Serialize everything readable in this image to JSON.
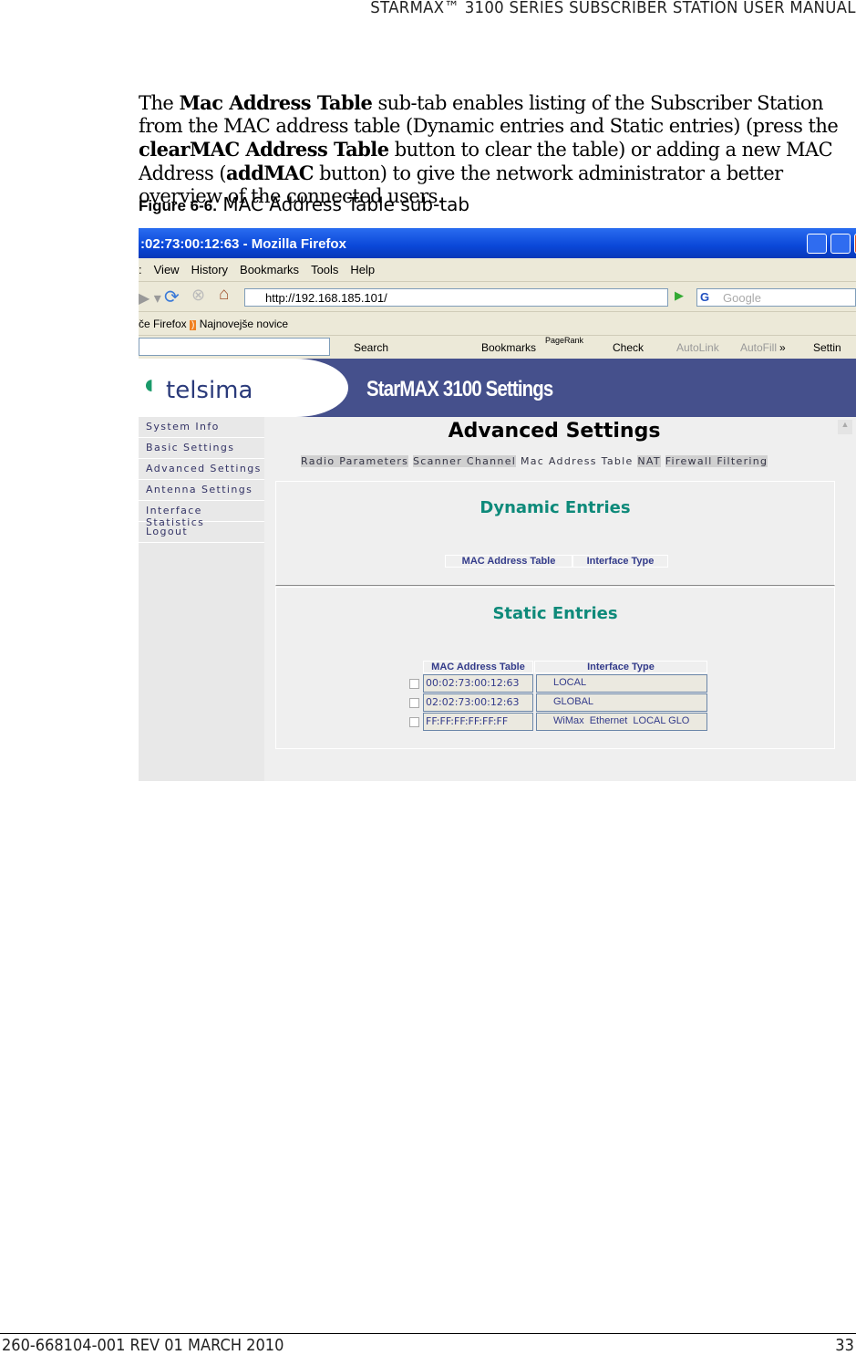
{
  "header": "STARMAX™ 3100 SERIES SUBSCRIBER STATION USER MANUAL",
  "paragraph": [
    {
      "t": "The "
    },
    {
      "b": "Mac Address Table"
    },
    {
      "t": " sub-tab enables listing of the Subscriber Station from the MAC address table (Dynamic entries and Static entries) (press the "
    },
    {
      "b": "clearMAC Address Table"
    },
    {
      "t": " button to clear the table) or adding a new MAC Address ("
    },
    {
      "b": "addMAC"
    },
    {
      "t": " button) to give the network administrator a better overview of the connected users."
    }
  ],
  "figure": {
    "label": "Figure 6-6.",
    "title": "MAC Address Table sub-tab"
  },
  "browser": {
    "title": ":02:73:00:12:63 - Mozilla Firefox",
    "menu": [
      ":",
      "View",
      "History",
      "Bookmarks",
      "Tools",
      "Help"
    ],
    "url": "http://192.168.185.101/",
    "search_placeholder": "Google",
    "bookmarks": [
      "če Firefox",
      "Najnovejše novice"
    ],
    "toolbar": [
      "Search",
      "Bookmarks",
      "PageRank",
      "Check",
      "AutoLink",
      "AutoFill",
      "»",
      "Settin"
    ]
  },
  "app": {
    "logo": "telsima",
    "banner_title": "StarMAX 3100 Settings",
    "sidebar": [
      "System Info",
      "Basic Settings",
      "Advanced Settings",
      "Antenna Settings",
      "Interface Statistics",
      "Logout"
    ],
    "page_title": "Advanced Settings",
    "tabs": [
      "Radio Parameters",
      "Scanner Channel",
      "Mac Address Table",
      "NAT",
      "Firewall Filtering"
    ],
    "active_tab": "Mac Address Table",
    "dynamic": {
      "title": "Dynamic Entries",
      "columns": [
        "MAC Address Table",
        "Interface Type"
      ]
    },
    "static": {
      "title": "Static Entries",
      "columns": [
        "MAC Address Table",
        "Interface Type"
      ],
      "rows": [
        {
          "mac": "00:02:73:00:12:63",
          "type": "LOCAL"
        },
        {
          "mac": "02:02:73:00:12:63",
          "type": "GLOBAL"
        },
        {
          "mac": "FF:FF:FF:FF:FF:FF",
          "type": "WiMax  Ethernet  LOCAL GLO"
        }
      ]
    }
  },
  "colors": {
    "accent": "#0e8a7a",
    "banner": "#45508c",
    "titlebar": "#0a47d8"
  },
  "footer": {
    "left": "260-668104-001 REV 01 MARCH 2010",
    "right": "33"
  }
}
